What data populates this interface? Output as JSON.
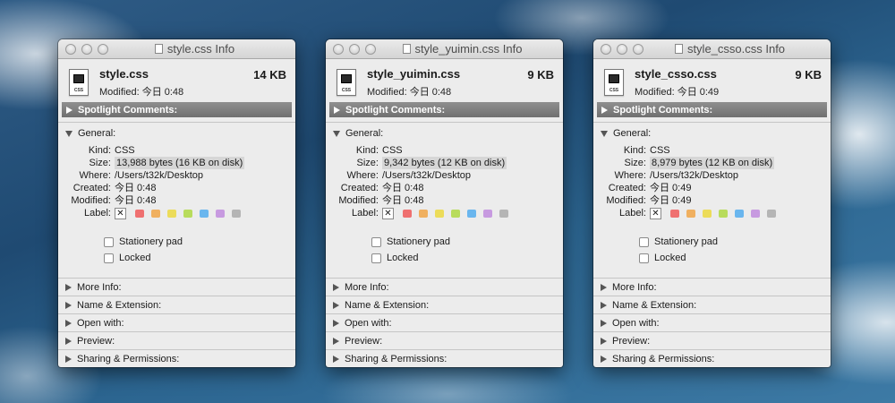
{
  "windows": [
    {
      "title": "style.css Info",
      "file_name": "style.css",
      "file_size": "14 KB",
      "modified_line": "Modified: 今日 0:48",
      "spotlight": "Spotlight Comments:",
      "general": "General:",
      "kind_label": "Kind:",
      "kind": "CSS",
      "size_label": "Size:",
      "size": "13,988 bytes (16 KB on disk)",
      "where_label": "Where:",
      "where": "/Users/t32k/Desktop",
      "created_label": "Created:",
      "created": "今日 0:48",
      "modified_label": "Modified:",
      "modified": "今日 0:48",
      "label_label": "Label:",
      "stationery": "Stationery pad",
      "locked": "Locked",
      "more_info": "More Info:",
      "name_ext": "Name & Extension:",
      "open_with": "Open with:",
      "preview": "Preview:",
      "sharing": "Sharing & Permissions:",
      "icon_label": "CSS"
    },
    {
      "title": "style_yuimin.css Info",
      "file_name": "style_yuimin.css",
      "file_size": "9 KB",
      "modified_line": "Modified: 今日 0:48",
      "spotlight": "Spotlight Comments:",
      "general": "General:",
      "kind_label": "Kind:",
      "kind": "CSS",
      "size_label": "Size:",
      "size": "9,342 bytes (12 KB on disk)",
      "where_label": "Where:",
      "where": "/Users/t32k/Desktop",
      "created_label": "Created:",
      "created": "今日 0:48",
      "modified_label": "Modified:",
      "modified": "今日 0:48",
      "label_label": "Label:",
      "stationery": "Stationery pad",
      "locked": "Locked",
      "more_info": "More Info:",
      "name_ext": "Name & Extension:",
      "open_with": "Open with:",
      "preview": "Preview:",
      "sharing": "Sharing & Permissions:",
      "icon_label": "CSS"
    },
    {
      "title": "style_csso.css Info",
      "file_name": "style_csso.css",
      "file_size": "9 KB",
      "modified_line": "Modified: 今日 0:49",
      "spotlight": "Spotlight Comments:",
      "general": "General:",
      "kind_label": "Kind:",
      "kind": "CSS",
      "size_label": "Size:",
      "size": "8,979 bytes (12 KB on disk)",
      "where_label": "Where:",
      "where": "/Users/t32k/Desktop",
      "created_label": "Created:",
      "created": "今日 0:49",
      "modified_label": "Modified:",
      "modified": "今日 0:49",
      "label_label": "Label:",
      "stationery": "Stationery pad",
      "locked": "Locked",
      "more_info": "More Info:",
      "name_ext": "Name & Extension:",
      "open_with": "Open with:",
      "preview": "Preview:",
      "sharing": "Sharing & Permissions:",
      "icon_label": "CSS"
    }
  ],
  "label_colors": [
    "#ef7070",
    "#f0b060",
    "#ecdc5a",
    "#b8dc5c",
    "#6ab6ee",
    "#c79ae0",
    "#b5b5b5"
  ]
}
